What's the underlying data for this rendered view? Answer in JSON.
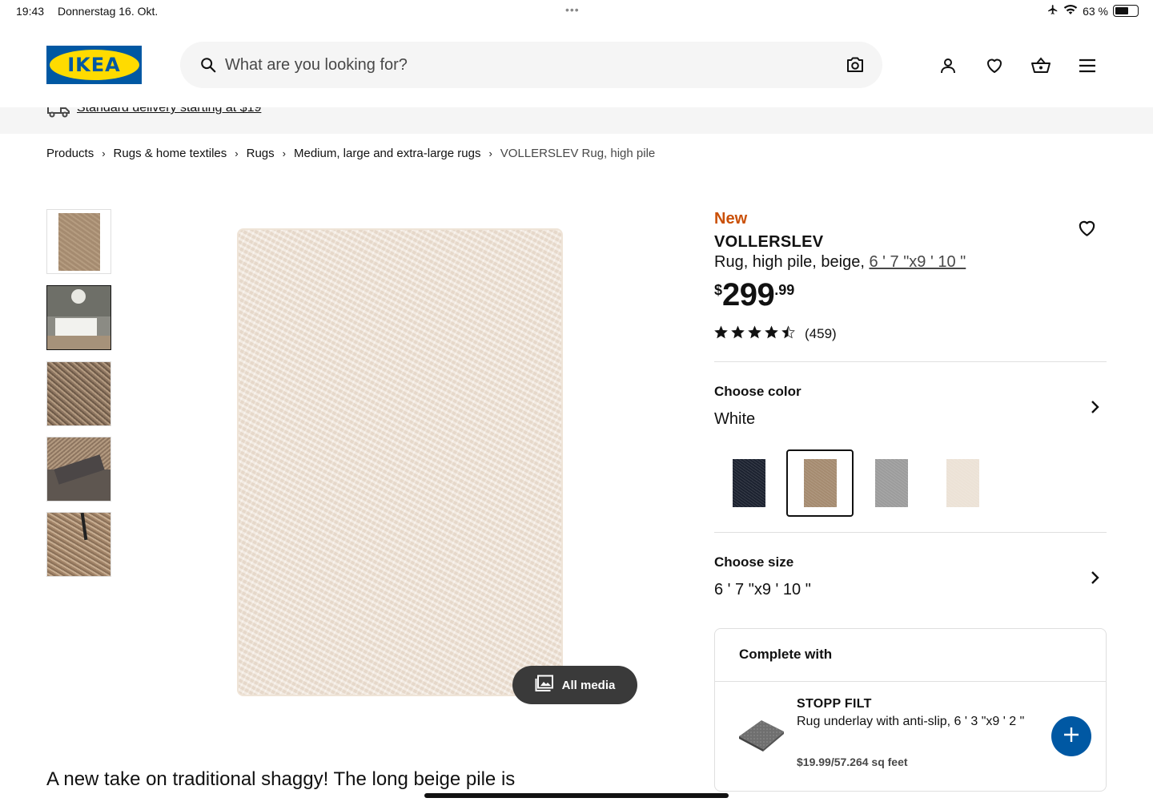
{
  "status_bar": {
    "time": "19:43",
    "date": "Donnerstag 16. Okt.",
    "battery": "63 %",
    "battery_level": 0.63
  },
  "header": {
    "logo_text": "IKEA",
    "search_placeholder": "What are you looking for?",
    "icons": [
      "search-icon",
      "camera-icon",
      "user-icon",
      "heart-icon",
      "basket-icon",
      "menu-icon"
    ]
  },
  "delivery": {
    "text": "Standard delivery starting at $19"
  },
  "breadcrumb": [
    "Products",
    "Rugs & home textiles",
    "Rugs",
    "Medium, large and extra-large rugs",
    "VOLLERSLEV Rug, high pile"
  ],
  "gallery": {
    "all_media_label": "All media",
    "selected_thumb_index": 1
  },
  "product": {
    "badge": "New",
    "name": "VOLLERSLEV",
    "description": "Rug, high pile, beige, ",
    "size_link": "6 ' 7 \"x9 ' 10 \"",
    "price_currency": "$",
    "price_int": "299",
    "price_dec": ".99",
    "rating": 4.5,
    "rating_count": "(459)"
  },
  "color_section": {
    "label": "Choose color",
    "value": "White",
    "swatches": [
      {
        "color": "#1c2230"
      },
      {
        "color": "#a58b70"
      },
      {
        "color": "#9c9c9c"
      },
      {
        "color": "#ece2d6"
      }
    ],
    "selected_index": 1
  },
  "size_section": {
    "label": "Choose size",
    "value": "6 ' 7 \"x9 ' 10 \""
  },
  "complete_with": {
    "title": "Complete with",
    "item": {
      "name": "STOPP FILT",
      "description": "Rug underlay with anti-slip, 6 ' 3 \"x9 ' 2 \"",
      "price": "$19.99/57.264 sq feet"
    }
  },
  "description_text": "A new take on traditional shaggy! The long beige pile is",
  "colors": {
    "brand_blue": "#0058a3",
    "brand_yellow": "#ffdb00",
    "new_orange": "#ca5008"
  }
}
